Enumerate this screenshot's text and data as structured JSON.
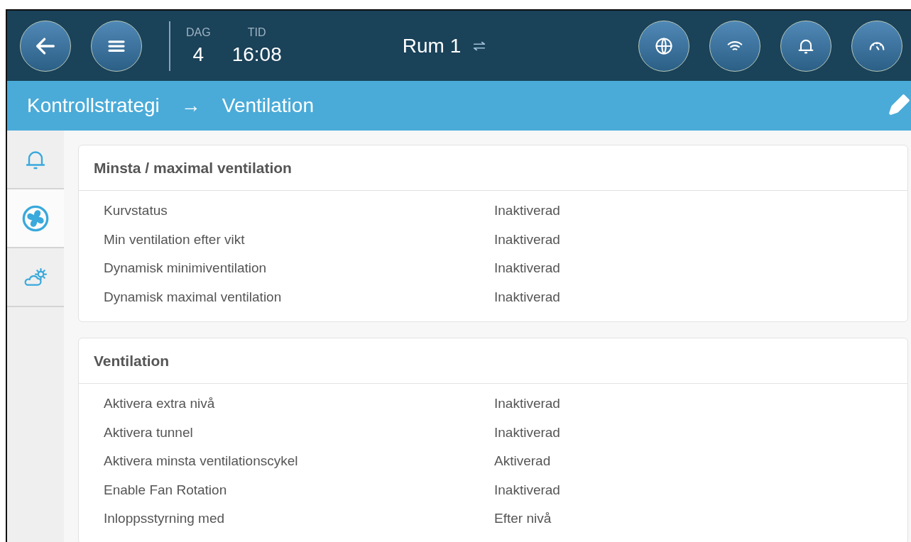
{
  "header": {
    "day_label": "DAG",
    "day": "4",
    "time_label": "TID",
    "time": "16:08",
    "room": "Rum 1"
  },
  "breadcrumb": {
    "parent": "Kontrollstrategi",
    "arrow": "→",
    "current": "Ventilation"
  },
  "sidebar": {
    "items": [
      {
        "kind": "bell",
        "selected": false
      },
      {
        "kind": "fan",
        "selected": true
      },
      {
        "kind": "weather",
        "selected": false
      }
    ]
  },
  "sections": [
    {
      "title": "Minsta / maximal ventilation",
      "rows": [
        {
          "label": "Kurvstatus",
          "value": "Inaktiverad"
        },
        {
          "label": "Min ventilation efter vikt",
          "value": "Inaktiverad"
        },
        {
          "label": "Dynamisk minimiventilation",
          "value": "Inaktiverad"
        },
        {
          "label": "Dynamisk maximal ventilation",
          "value": "Inaktiverad"
        }
      ]
    },
    {
      "title": "Ventilation",
      "rows": [
        {
          "label": "Aktivera extra nivå",
          "value": "Inaktiverad"
        },
        {
          "label": "Aktivera tunnel",
          "value": "Inaktiverad"
        },
        {
          "label": "Aktivera minsta ventilationscykel",
          "value": "Aktiverad"
        },
        {
          "label": "Enable Fan Rotation",
          "value": "Inaktiverad"
        },
        {
          "label": "Inloppsstyrning med",
          "value": "Efter nivå"
        }
      ]
    }
  ]
}
